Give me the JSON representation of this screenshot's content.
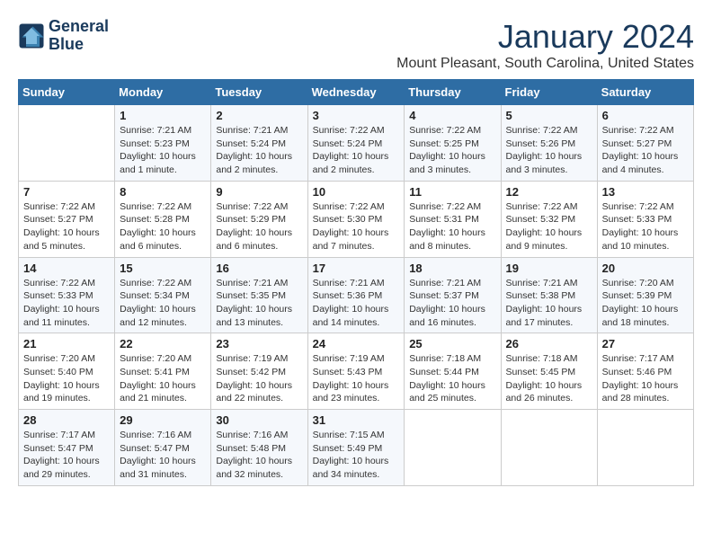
{
  "header": {
    "logo_line1": "General",
    "logo_line2": "Blue",
    "month": "January 2024",
    "location": "Mount Pleasant, South Carolina, United States"
  },
  "weekdays": [
    "Sunday",
    "Monday",
    "Tuesday",
    "Wednesday",
    "Thursday",
    "Friday",
    "Saturday"
  ],
  "weeks": [
    [
      {
        "day": "",
        "content": ""
      },
      {
        "day": "1",
        "content": "Sunrise: 7:21 AM\nSunset: 5:23 PM\nDaylight: 10 hours\nand 1 minute."
      },
      {
        "day": "2",
        "content": "Sunrise: 7:21 AM\nSunset: 5:24 PM\nDaylight: 10 hours\nand 2 minutes."
      },
      {
        "day": "3",
        "content": "Sunrise: 7:22 AM\nSunset: 5:24 PM\nDaylight: 10 hours\nand 2 minutes."
      },
      {
        "day": "4",
        "content": "Sunrise: 7:22 AM\nSunset: 5:25 PM\nDaylight: 10 hours\nand 3 minutes."
      },
      {
        "day": "5",
        "content": "Sunrise: 7:22 AM\nSunset: 5:26 PM\nDaylight: 10 hours\nand 3 minutes."
      },
      {
        "day": "6",
        "content": "Sunrise: 7:22 AM\nSunset: 5:27 PM\nDaylight: 10 hours\nand 4 minutes."
      }
    ],
    [
      {
        "day": "7",
        "content": "Sunrise: 7:22 AM\nSunset: 5:27 PM\nDaylight: 10 hours\nand 5 minutes."
      },
      {
        "day": "8",
        "content": "Sunrise: 7:22 AM\nSunset: 5:28 PM\nDaylight: 10 hours\nand 6 minutes."
      },
      {
        "day": "9",
        "content": "Sunrise: 7:22 AM\nSunset: 5:29 PM\nDaylight: 10 hours\nand 6 minutes."
      },
      {
        "day": "10",
        "content": "Sunrise: 7:22 AM\nSunset: 5:30 PM\nDaylight: 10 hours\nand 7 minutes."
      },
      {
        "day": "11",
        "content": "Sunrise: 7:22 AM\nSunset: 5:31 PM\nDaylight: 10 hours\nand 8 minutes."
      },
      {
        "day": "12",
        "content": "Sunrise: 7:22 AM\nSunset: 5:32 PM\nDaylight: 10 hours\nand 9 minutes."
      },
      {
        "day": "13",
        "content": "Sunrise: 7:22 AM\nSunset: 5:33 PM\nDaylight: 10 hours\nand 10 minutes."
      }
    ],
    [
      {
        "day": "14",
        "content": "Sunrise: 7:22 AM\nSunset: 5:33 PM\nDaylight: 10 hours\nand 11 minutes."
      },
      {
        "day": "15",
        "content": "Sunrise: 7:22 AM\nSunset: 5:34 PM\nDaylight: 10 hours\nand 12 minutes."
      },
      {
        "day": "16",
        "content": "Sunrise: 7:21 AM\nSunset: 5:35 PM\nDaylight: 10 hours\nand 13 minutes."
      },
      {
        "day": "17",
        "content": "Sunrise: 7:21 AM\nSunset: 5:36 PM\nDaylight: 10 hours\nand 14 minutes."
      },
      {
        "day": "18",
        "content": "Sunrise: 7:21 AM\nSunset: 5:37 PM\nDaylight: 10 hours\nand 16 minutes."
      },
      {
        "day": "19",
        "content": "Sunrise: 7:21 AM\nSunset: 5:38 PM\nDaylight: 10 hours\nand 17 minutes."
      },
      {
        "day": "20",
        "content": "Sunrise: 7:20 AM\nSunset: 5:39 PM\nDaylight: 10 hours\nand 18 minutes."
      }
    ],
    [
      {
        "day": "21",
        "content": "Sunrise: 7:20 AM\nSunset: 5:40 PM\nDaylight: 10 hours\nand 19 minutes."
      },
      {
        "day": "22",
        "content": "Sunrise: 7:20 AM\nSunset: 5:41 PM\nDaylight: 10 hours\nand 21 minutes."
      },
      {
        "day": "23",
        "content": "Sunrise: 7:19 AM\nSunset: 5:42 PM\nDaylight: 10 hours\nand 22 minutes."
      },
      {
        "day": "24",
        "content": "Sunrise: 7:19 AM\nSunset: 5:43 PM\nDaylight: 10 hours\nand 23 minutes."
      },
      {
        "day": "25",
        "content": "Sunrise: 7:18 AM\nSunset: 5:44 PM\nDaylight: 10 hours\nand 25 minutes."
      },
      {
        "day": "26",
        "content": "Sunrise: 7:18 AM\nSunset: 5:45 PM\nDaylight: 10 hours\nand 26 minutes."
      },
      {
        "day": "27",
        "content": "Sunrise: 7:17 AM\nSunset: 5:46 PM\nDaylight: 10 hours\nand 28 minutes."
      }
    ],
    [
      {
        "day": "28",
        "content": "Sunrise: 7:17 AM\nSunset: 5:47 PM\nDaylight: 10 hours\nand 29 minutes."
      },
      {
        "day": "29",
        "content": "Sunrise: 7:16 AM\nSunset: 5:47 PM\nDaylight: 10 hours\nand 31 minutes."
      },
      {
        "day": "30",
        "content": "Sunrise: 7:16 AM\nSunset: 5:48 PM\nDaylight: 10 hours\nand 32 minutes."
      },
      {
        "day": "31",
        "content": "Sunrise: 7:15 AM\nSunset: 5:49 PM\nDaylight: 10 hours\nand 34 minutes."
      },
      {
        "day": "",
        "content": ""
      },
      {
        "day": "",
        "content": ""
      },
      {
        "day": "",
        "content": ""
      }
    ]
  ]
}
